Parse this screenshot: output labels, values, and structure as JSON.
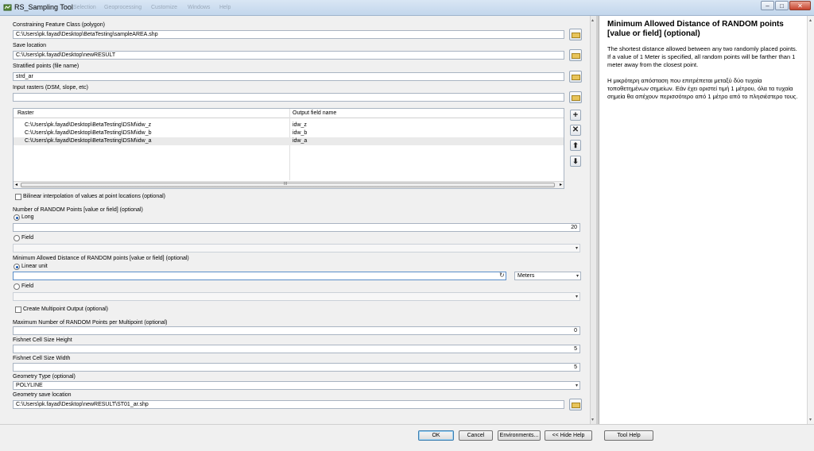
{
  "window": {
    "title": "RS_Sampling Tool",
    "menu_ghost": [
      "Selection",
      "Geoprocessing",
      "Customize",
      "Windows",
      "Help"
    ],
    "controls": {
      "minimize": "–",
      "maximize": "□",
      "close": "✕"
    }
  },
  "form": {
    "constraining_label": "Constraining Feature Class (polygon)",
    "constraining_value": "C:\\Users\\pk.fayad\\Desktop\\BetaTesting\\sampleAREA.shp",
    "save_location_label": "Save location",
    "save_location_value": "C:\\Users\\pk.fayad\\Desktop\\newRESULT",
    "stratified_label": "Stratified points (file name)",
    "stratified_value": "strd_ar",
    "input_rasters_label": "Input rasters (DSM, slope, etc)",
    "input_rasters_value": "",
    "raster_table": {
      "headers": [
        "Raster",
        "Output field name"
      ],
      "rows": [
        {
          "raster": "C:\\Users\\pk.fayad\\Desktop\\BetaTesting\\DSM\\idw_z",
          "field": "idw_z"
        },
        {
          "raster": "C:\\Users\\pk.fayad\\Desktop\\BetaTesting\\DSM\\idw_b",
          "field": "idw_b"
        },
        {
          "raster": "C:\\Users\\pk.fayad\\Desktop\\BetaTesting\\DSM\\idw_a",
          "field": "idw_a"
        }
      ],
      "scroll_left": "◂",
      "scroll_right": "▸",
      "scroll_grip": "III"
    },
    "side_buttons": {
      "add": "+",
      "remove": "✕",
      "up": "⬆",
      "down": "⬇"
    },
    "bilinear_label": "Bilinear interpolation of values at point locations (optional)",
    "num_random_label": "Number of RANDOM Points [value or field] (optional)",
    "long_label": "Long",
    "long_value": "20",
    "field1_label": "Field",
    "min_dist_label": "Minimum Allowed Distance of RANDOM points [value or field] (optional)",
    "linear_unit_label": "Linear unit",
    "linear_unit_value": "",
    "unit_select": "Meters",
    "field2_label": "Field",
    "multipoint_label": "Create Multipoint Output (optional)",
    "max_per_multi_label": "Maximum Number of RANDOM Points per Multipoint (optional)",
    "max_per_multi_value": "0",
    "fishnet_h_label": "Fishnet Cell Size Height",
    "fishnet_h_value": "5",
    "fishnet_w_label": "Fishnet Cell Size Width",
    "fishnet_w_value": "5",
    "geom_type_label": "Geometry Type (optional)",
    "geom_type_value": "POLYLINE",
    "geom_save_label": "Geometry save location",
    "geom_save_value": "C:\\Users\\pk.fayad\\Desktop\\newRESULT\\ST01_ar.shp"
  },
  "help": {
    "title": "Minimum Allowed Distance of RANDOM points [value or field] (optional)",
    "para_en": "The shortest distance allowed between any two randomly placed points. If a value of 1 Meter is specified, all random points will be farther than 1 meter away from the closest point.",
    "para_el": "Η μικρότερη απόσταση που επιτρέπεται μεταξύ δύο τυχαία τοποθετημένων σημείων. Εάν έχει οριστεί τιμή 1 μέτρου, όλα τα τυχαία σημεία θα απέχουν περισσότερο από 1 μέτρο από το πλησιέστερο τους."
  },
  "buttons": {
    "ok": "OK",
    "cancel": "Cancel",
    "environments": "Environments...",
    "hide_help": "<< Hide Help",
    "tool_help": "Tool Help"
  },
  "colors": {
    "titlebar": "#c9dbef",
    "help_bg": "#ffffff",
    "accent": "#1a57b0"
  }
}
